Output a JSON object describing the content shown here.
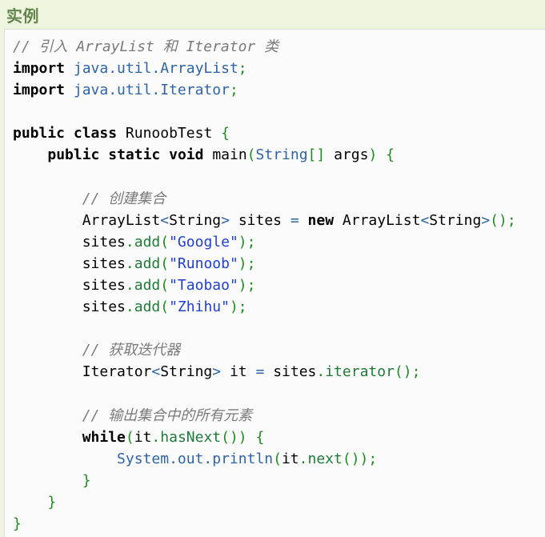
{
  "header": {
    "title": "实例"
  },
  "code": {
    "c1": "// 引入 ArrayList 和 Iterator 类",
    "kw_import": "import",
    "pkg_arraylist": "java.util.ArrayList",
    "pkg_iterator": "java.util.Iterator",
    "kw_public": "public",
    "kw_class": "class",
    "class_name": "RunoobTest",
    "kw_static": "static",
    "kw_void": "void",
    "main": "main",
    "type_string": "String",
    "args": "args",
    "c2": "// 创建集合",
    "type_arraylist": "ArrayList",
    "var_sites": "sites",
    "kw_new": "new",
    "add": "add",
    "s_google": "\"Google\"",
    "s_runoob": "\"Runoob\"",
    "s_taobao": "\"Taobao\"",
    "s_zhihu": "\"Zhihu\"",
    "c3": "// 获取迭代器",
    "type_iterator": "Iterator",
    "var_it": "it",
    "iterator_call": "iterator",
    "c4": "// 输出集合中的所有元素",
    "kw_while": "while",
    "hasnext": "hasNext",
    "system_out": "System.out.println",
    "next": "next"
  }
}
